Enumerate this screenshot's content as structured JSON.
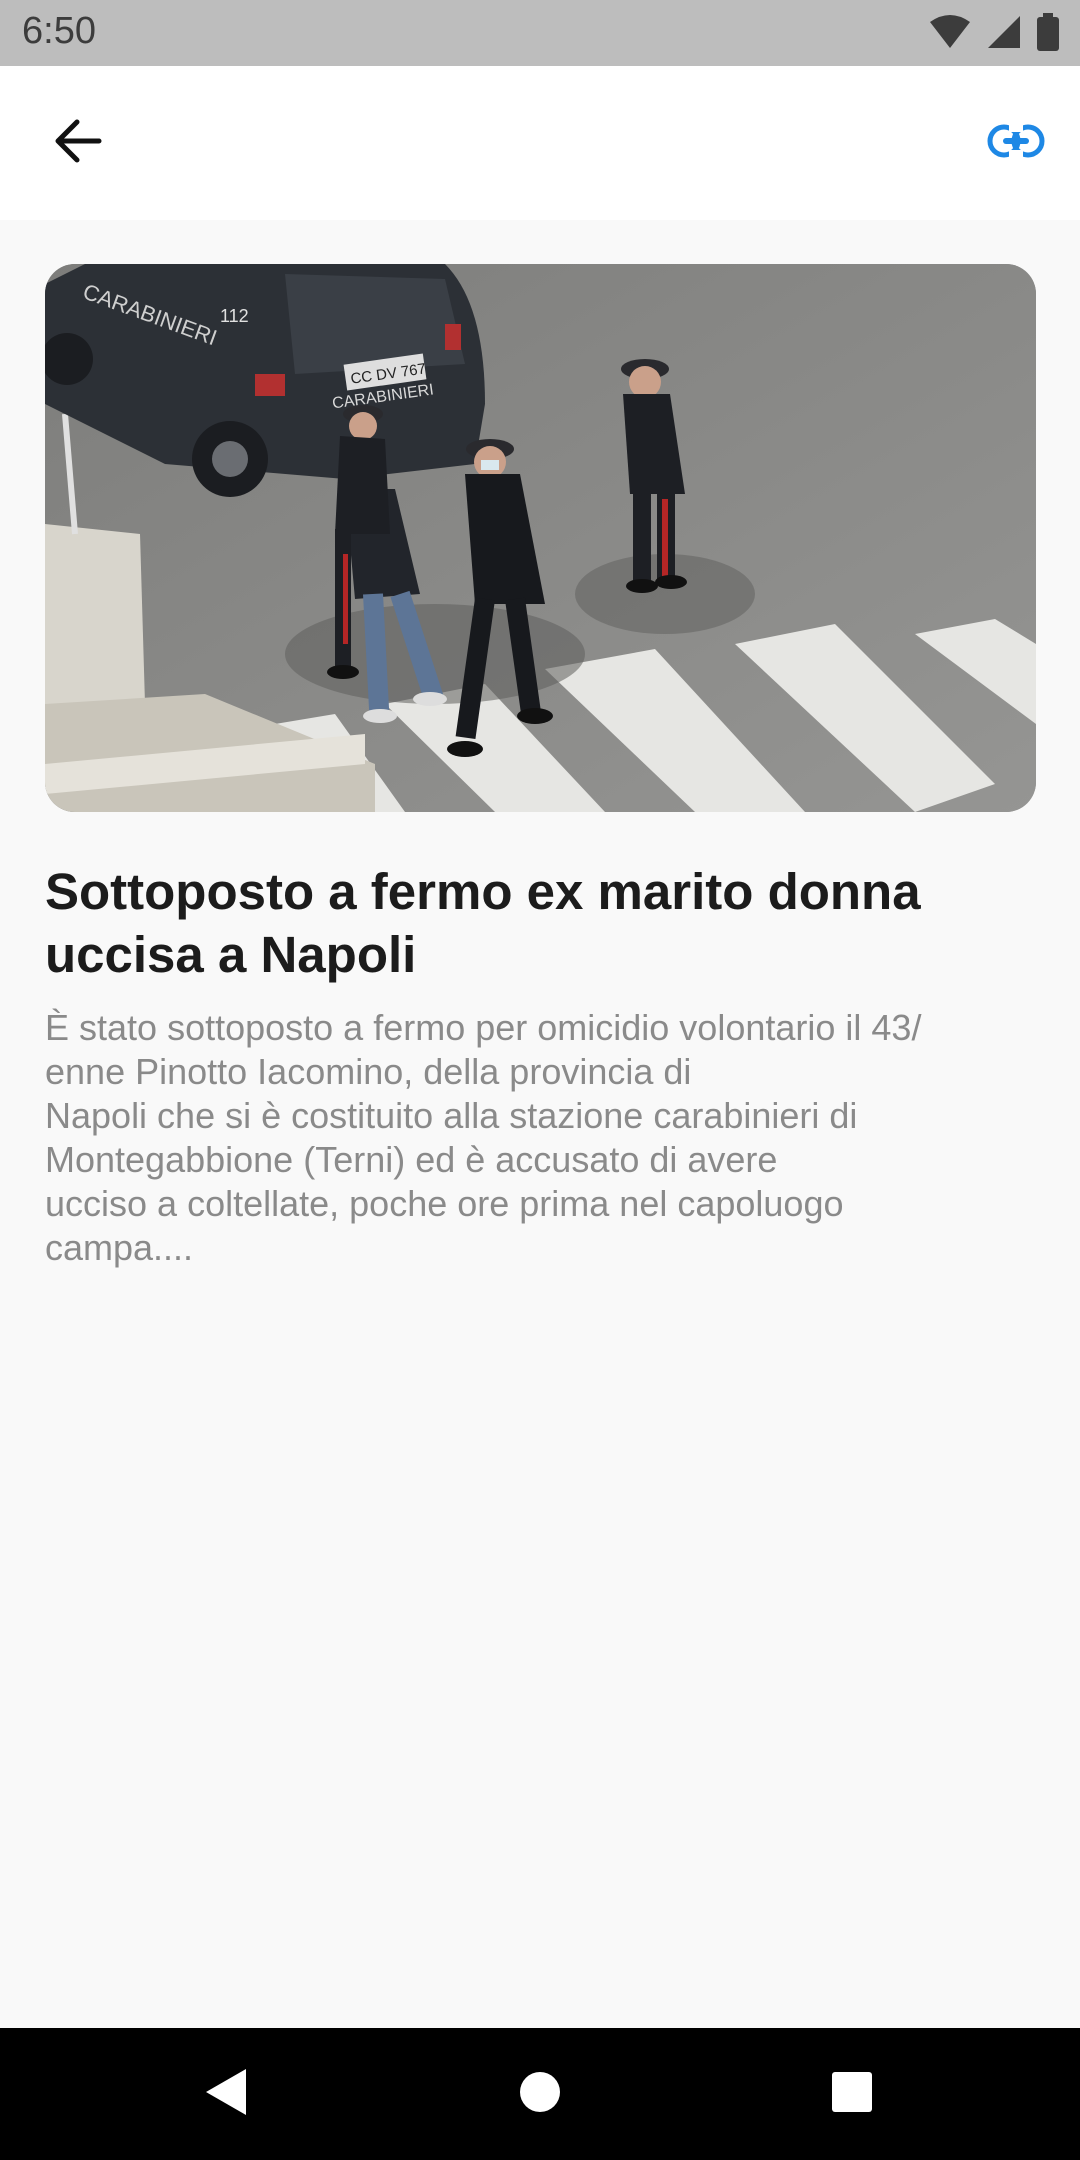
{
  "status_bar": {
    "time": "6:50",
    "icons": [
      "wifi-icon",
      "signal-icon",
      "battery-icon"
    ]
  },
  "app_bar": {
    "back_icon": "arrow-left-icon",
    "link_icon": "link-icon",
    "accent_color": "#1e88e5"
  },
  "article": {
    "image_description": "photo-carabinieri-arrest",
    "title": "Sottoposto a fermo ex marito donna uccisa a Napoli",
    "summary": "È stato sottoposto a fermo per omicidio volontario il 43/\nenne Pinotto Iacomino, della provincia di\nNapoli che si è costituito alla stazione carabinieri di\nMontegabbione (Terni) ed è accusato di avere\nucciso a coltellate, poche ore prima nel capoluogo\ncampa...."
  },
  "hero_image_text": {
    "car_door": "CARABINIERI",
    "car_number": "112",
    "plate": "CC DV 767",
    "plate_caption": "CARABINIERI"
  },
  "nav_bar": {
    "back": "triangle-back-icon",
    "home": "circle-home-icon",
    "recents": "square-recents-icon"
  }
}
